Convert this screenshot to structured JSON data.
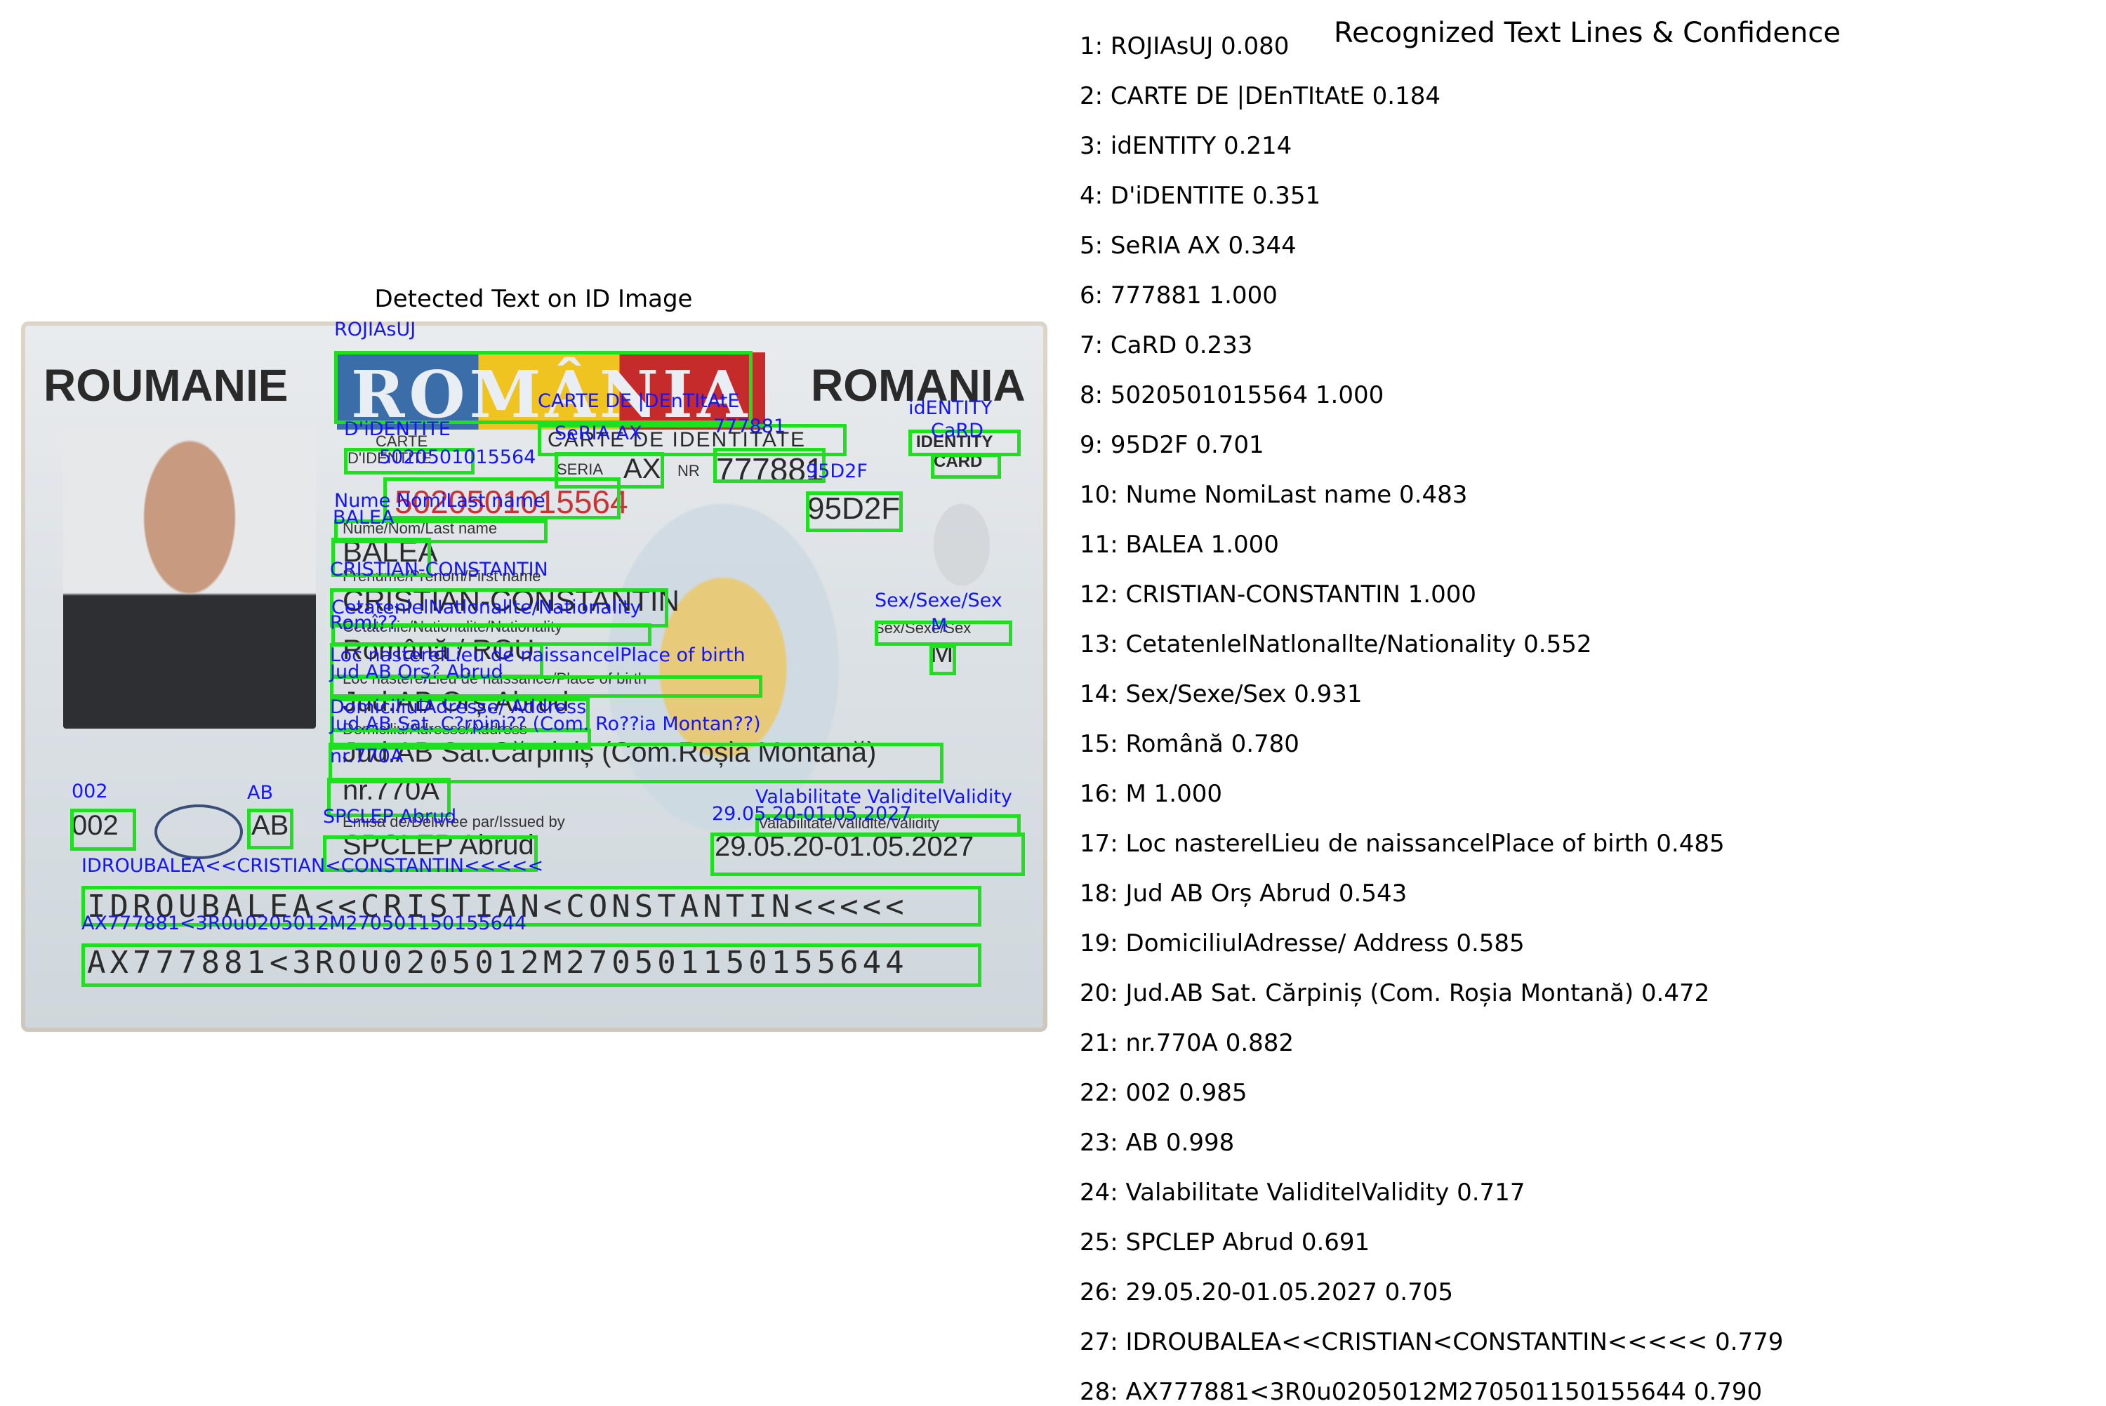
{
  "panel_title": "Detected Text on ID Image",
  "results_title": "Recognized Text Lines & Confidence",
  "card_printed": {
    "roumanie": "ROUMANIE",
    "romania": "ROMANIA",
    "flag_word": "ROMÂNIA",
    "carte": "CARTE",
    "didentite": "D'IDENTITE",
    "carte_de_identitate": "CARTE DE IDENTITATE",
    "identity": "IDENTITY",
    "card": "CARD",
    "seria": "SERIA",
    "ax": "AX",
    "nr": "NR",
    "number": "777881",
    "cnp": "5020501015564",
    "code": "95D2F",
    "nume_label": "Nume/Nom/Last name",
    "last_name": "BALEA",
    "prenume_label": "Prenume/Prenom/First name",
    "first_name": "CRISTIAN-CONSTANTIN",
    "cetatenie_label": "Cetatenie/Nationalite/Nationality",
    "nationality": "Română / ROU",
    "sex_label": "Sex/Sexe/Sex",
    "sex": "M",
    "loc_label": "Loc nastere/Lieu de naissance/Place of birth",
    "birth_place": "Jud.AB Orș.Abrud",
    "domiciliu_label": "Domiciliu/Adresse/Address",
    "address1": "Jud.AB Sat.Cărpiniș (Com.Roșia Montană)",
    "address2": "nr.770A",
    "emisa_label": "Emisa de/Delivree par/Issued by",
    "issuer": "SPCLEP Abrud",
    "valab_label": "Valabilitate/Validite/Validity",
    "validity": "29.05.20-01.05.2027",
    "num002": "002",
    "ab": "AB",
    "mrz1": "IDROUBALEA<<CRISTIAN<CONSTANTIN<<<<<",
    "mrz2": "AX777881<3ROU0205012M270501150155644"
  },
  "detections": [
    {
      "label": "ROJIAsUJ"
    },
    {
      "label": "CARTE DE |DEnTItAtE"
    },
    {
      "label": "idENTITY"
    },
    {
      "label": "D'iDENTITE"
    },
    {
      "label": "SeRIA AX"
    },
    {
      "label": "777881"
    },
    {
      "label": "CaRD"
    },
    {
      "label": "5020501015564"
    },
    {
      "label": "95D2F"
    },
    {
      "label": "Nume NomiLast name"
    },
    {
      "label": "BALEA"
    },
    {
      "label": "CRISTIAN-CONSTANTIN"
    },
    {
      "label": "CetatenlelNatlonallte/Nationality"
    },
    {
      "label": "Sex/Sexe/Sex"
    },
    {
      "label": "Romî??"
    },
    {
      "label": "M"
    },
    {
      "label": "Loc nasterelLieu de naissancelPlace of birth"
    },
    {
      "label": "Jud AB Orș? Abrud"
    },
    {
      "label": "DomiciliulAdresse/ Address"
    },
    {
      "label": "Jud.AB Sat. C?rpini?? (Com. Ro??ia Montan??)"
    },
    {
      "label": "nr.770A"
    },
    {
      "label": "002"
    },
    {
      "label": "AB"
    },
    {
      "label": "Valabilitate ValiditelValidity"
    },
    {
      "label": "SPCLEP Abrud"
    },
    {
      "label": "29.05.20-01.05.2027"
    },
    {
      "label": "IDROUBALEA<<CRISTIAN<CONSTANTIN<<<<<"
    },
    {
      "label": "AX777881<3R0u0205012M270501150155644"
    }
  ],
  "results": [
    "1: ROJIAsUJ  0.080",
    "2: CARTE DE |DEnTItAtE  0.184",
    "3: idENTITY  0.214",
    "4: D'iDENTITE  0.351",
    "5: SeRIA AX  0.344",
    "6: 777881  1.000",
    "7: CaRD  0.233",
    "8: 5020501015564  1.000",
    "9: 95D2F  0.701",
    "10: Nume NomiLast name  0.483",
    "11: BALEA  1.000",
    "12: CRISTIAN-CONSTANTIN  1.000",
    "13: CetatenlelNatlonallte/Nationality  0.552",
    "14: Sex/Sexe/Sex  0.931",
    "15: Română  0.780",
    "16: M  1.000",
    "17: Loc nasterelLieu de naissancelPlace of birth  0.485",
    "18: Jud AB Orș Abrud  0.543",
    "19: DomiciliulAdresse/ Address  0.585",
    "20: Jud.AB Sat. Cărpiniș (Com. Roșia Montană)  0.472",
    "21: nr.770A  0.882",
    "22: 002  0.985",
    "23: AB  0.998",
    "24: Valabilitate ValiditelValidity  0.717",
    "25: SPCLEP Abrud  0.691",
    "26: 29.05.20-01.05.2027  0.705",
    "27: IDROUBALEA<<CRISTIAN<CONSTANTIN<<<<<  0.779",
    "28: AX777881<3R0u0205012M270501150155644  0.790"
  ]
}
